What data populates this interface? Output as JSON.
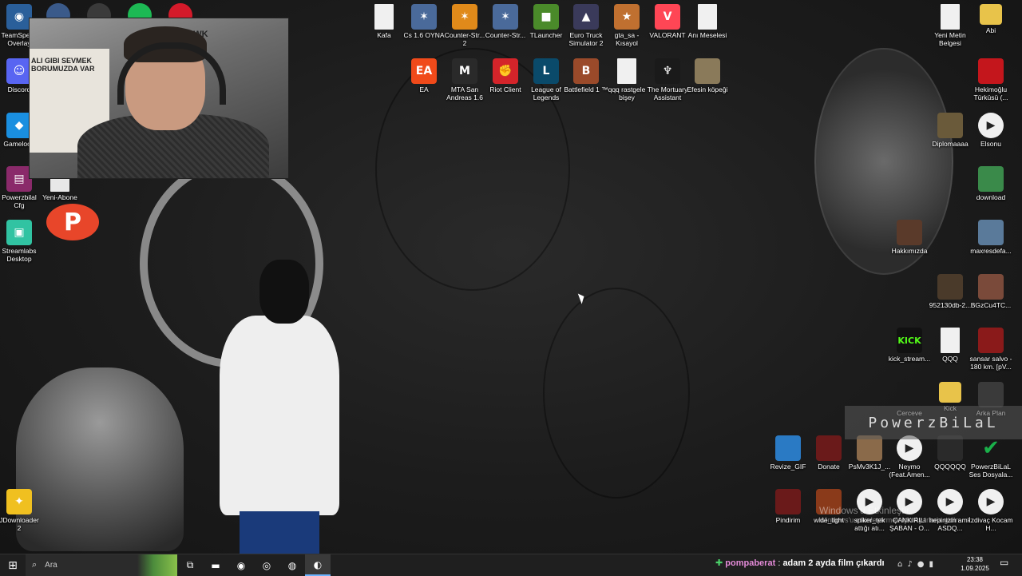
{
  "desktop": {
    "icons_left": [
      {
        "label": "TeamSpeak Overlay",
        "icon": "teamspeak-icon",
        "color": "#2a5f9a",
        "glyph": "◉"
      },
      {
        "label": "Discord",
        "icon": "discord-icon",
        "color": "#5865f2",
        "glyph": "☺"
      },
      {
        "label": "Gameloop",
        "icon": "gameloop-icon",
        "color": "#1a8fe0",
        "glyph": "◆"
      },
      {
        "label": "Powerzbilal Cfg",
        "icon": "winrar-icon",
        "color": "#8a2a6a",
        "glyph": "▤"
      },
      {
        "label": "Yeni-Abone",
        "icon": "text-file-icon",
        "color": "#e8e8e8",
        "glyph": ""
      },
      {
        "label": "Streamlabs Desktop",
        "icon": "streamlabs-icon",
        "color": "#31c3a2",
        "glyph": "▣"
      },
      {
        "label": "JDownloader 2",
        "icon": "jdownloader-icon",
        "color": "#f0c020",
        "glyph": "✦"
      }
    ],
    "top_left_row": [
      {
        "icon": "obs-icon",
        "color": "#3a5a8a"
      },
      {
        "icon": "github-icon",
        "color": "#3a3a3a"
      },
      {
        "icon": "spotify-icon",
        "color": "#1db954"
      },
      {
        "icon": "opera-icon",
        "color": "#d41a2a"
      }
    ],
    "icons_top": [
      {
        "label": "Kafa",
        "icon": "text-file-icon",
        "color": "#f0f0f0",
        "glyph": ""
      },
      {
        "label": "Cs 1.6 OYNA",
        "icon": "counter-strike-icon",
        "color": "#4a6a9a",
        "glyph": "✶"
      },
      {
        "label": "Counter-Str... 2",
        "icon": "cs2-icon",
        "color": "#e08a1a",
        "glyph": "✶"
      },
      {
        "label": "Counter-Str...",
        "icon": "counter-strike-icon",
        "color": "#4a6a9a",
        "glyph": "✶"
      },
      {
        "label": "TLauncher",
        "icon": "tlauncher-icon",
        "color": "#4a8a2a",
        "glyph": "■"
      },
      {
        "label": "Euro Truck Simulator 2",
        "icon": "truck-icon",
        "color": "#3a3a5a",
        "glyph": "▲"
      },
      {
        "label": "gta_sa - Kısayol",
        "icon": "gta-icon",
        "color": "#c07030",
        "glyph": "★"
      },
      {
        "label": "VALORANT",
        "icon": "valorant-icon",
        "color": "#ff4655",
        "glyph": "V"
      },
      {
        "label": "Anı Meselesi",
        "icon": "text-file-icon",
        "color": "#f0f0f0",
        "glyph": ""
      },
      {
        "label": "EA",
        "icon": "ea-icon",
        "color": "#f04a1a",
        "glyph": "EA"
      },
      {
        "label": "MTA San Andreas 1.6",
        "icon": "mta-icon",
        "color": "#2a2a2a",
        "glyph": "M"
      },
      {
        "label": "Riot Client",
        "icon": "riot-icon",
        "color": "#d4242a",
        "glyph": "✊"
      },
      {
        "label": "League of Legends",
        "icon": "lol-icon",
        "color": "#0a4a6a",
        "glyph": "L"
      },
      {
        "label": "Battlefield 1 ™",
        "icon": "battlefield-icon",
        "color": "#9a4a2a",
        "glyph": "B"
      },
      {
        "label": "qqq rastgele bişey",
        "icon": "text-file-icon",
        "color": "#f0f0f0",
        "glyph": ""
      },
      {
        "label": "The Mortuary Assistant",
        "icon": "mortuary-icon",
        "color": "#1a1a1a",
        "glyph": "♆"
      },
      {
        "label": "Efesin köpeği",
        "icon": "image-file-icon",
        "color": "#8a7a5a",
        "glyph": ""
      }
    ],
    "icons_right": [
      {
        "label": "Yeni Metin Belgesi",
        "icon": "text-file-icon",
        "color": "#f0f0f0",
        "glyph": ""
      },
      {
        "label": "Abi",
        "icon": "folder-icon",
        "color": "#e8c34a",
        "glyph": ""
      },
      {
        "label": "Hekimoğlu Türküsü (...",
        "icon": "video-file-icon",
        "color": "#c4161c",
        "glyph": ""
      },
      {
        "label": "Diplomaaaa",
        "icon": "image-file-icon",
        "color": "#6a5a3a",
        "glyph": ""
      },
      {
        "label": "Elsonu",
        "icon": "media-icon",
        "color": "#f0f0f0",
        "glyph": "▶"
      },
      {
        "label": "download",
        "icon": "image-file-icon",
        "color": "#3a8a4a",
        "glyph": ""
      },
      {
        "label": "Hakkımızda",
        "icon": "image-file-icon",
        "color": "#5a3a2a",
        "glyph": ""
      },
      {
        "label": "maxresdefa...",
        "icon": "image-file-icon",
        "color": "#5a7a9a",
        "glyph": ""
      },
      {
        "label": "952130db-2...",
        "icon": "image-file-icon",
        "color": "#4a3a2a",
        "glyph": ""
      },
      {
        "label": "BGzCu4TC...",
        "icon": "image-file-icon",
        "color": "#7a4a3a",
        "glyph": ""
      },
      {
        "label": "kick_stream...",
        "icon": "kick-icon",
        "color": "#111111",
        "glyph": "KICK"
      },
      {
        "label": "QQQ",
        "icon": "text-file-icon",
        "color": "#f0f0f0",
        "glyph": ""
      },
      {
        "label": "sansar salvo - 180 km. [pV...",
        "icon": "video-file-icon",
        "color": "#8a1a1a",
        "glyph": ""
      },
      {
        "label": "Cerceve",
        "icon": "image-file-icon",
        "color": "#1a1a1a",
        "glyph": ""
      },
      {
        "label": "Kick",
        "icon": "folder-icon",
        "color": "#e8c34a",
        "glyph": ""
      },
      {
        "label": "Arka Plan",
        "icon": "image-file-icon",
        "color": "#3a3a3a",
        "glyph": ""
      },
      {
        "label": "Revize_GIF",
        "icon": "gif-file-icon",
        "color": "#2a7ac4",
        "glyph": ""
      },
      {
        "label": "Donate",
        "icon": "image-file-icon",
        "color": "#6a1a1a",
        "glyph": ""
      },
      {
        "label": "PsMv3K1J_...",
        "icon": "image-file-icon",
        "color": "#8a6a4a",
        "glyph": ""
      },
      {
        "label": "Neymo (Feat.Amen...",
        "icon": "media-icon",
        "color": "#f0f0f0",
        "glyph": "▶"
      },
      {
        "label": "QQQQQQ",
        "icon": "image-file-icon",
        "color": "#2a2a2a",
        "glyph": ""
      },
      {
        "label": "PowerzBiLaL Ses Dosyala...",
        "icon": "check-icon",
        "color": "#1ab04a",
        "glyph": "✔"
      },
      {
        "label": "Pindirim",
        "icon": "image-file-icon",
        "color": "#6a1a1a",
        "glyph": ""
      },
      {
        "label": "wide_light",
        "icon": "image-file-icon",
        "color": "#8a3a1a",
        "glyph": ""
      },
      {
        "label": "spiker_tek attığı atı...",
        "icon": "media-icon",
        "color": "#f0f0f0",
        "glyph": "▶"
      },
      {
        "label": "ÇANKIRILI ŞABAN - O...",
        "icon": "media-icon",
        "color": "#f0f0f0",
        "glyph": "▶"
      },
      {
        "label": "hepinizin amk ASDQ...",
        "icon": "media-icon",
        "color": "#f0f0f0",
        "glyph": "▶"
      },
      {
        "label": "İzdivaç Kocam H...",
        "icon": "media-icon",
        "color": "#f0f0f0",
        "glyph": "▶"
      }
    ],
    "webcam": {
      "chair_brand": "HAWK",
      "poster_text": "ALI GIBI SEVMEK BORUMUZDA VAR"
    },
    "overlay_banner": "PowerzBiLaL",
    "watermark": {
      "line1": "Windows'u Etkinleştir",
      "line2": "Windows'u etkinleştirmek için Ayarlar'a gidin."
    }
  },
  "taskbar": {
    "search_placeholder": "Ara",
    "apps": [
      {
        "name": "task-view-icon",
        "glyph": "⧉"
      },
      {
        "name": "file-explorer-icon",
        "glyph": "▬"
      },
      {
        "name": "chrome-icon",
        "glyph": "◉"
      },
      {
        "name": "steelseries-icon",
        "glyph": "◎"
      },
      {
        "name": "firefox-icon",
        "glyph": "◍"
      },
      {
        "name": "steam-icon",
        "glyph": "◐"
      }
    ],
    "chat": {
      "user": "pompaberat",
      "separator": ":",
      "message": "adam 2 ayda film çıkardı"
    },
    "clock": {
      "time": "23:38",
      "date": "1.09.2025"
    }
  },
  "colors": {
    "taskbar": "#1f1f1f",
    "accent": "#6cb4ff",
    "chat_user": "#e48bd8"
  }
}
